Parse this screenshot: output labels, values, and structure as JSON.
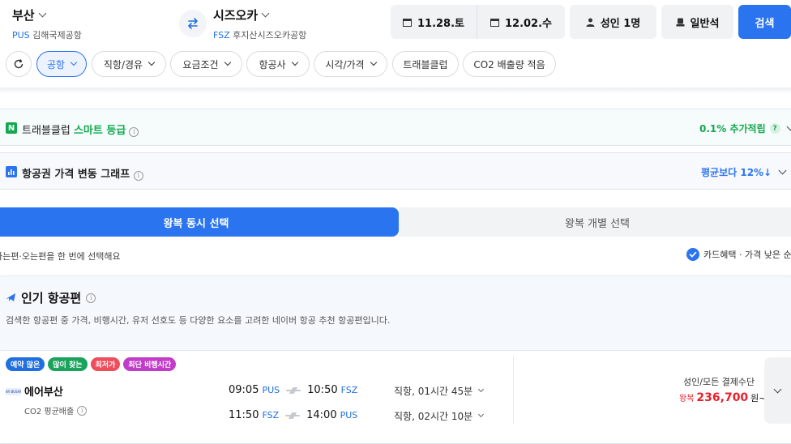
{
  "route": {
    "origin_city": "부산",
    "origin_code": "PUS",
    "origin_airport": "김해국제공항",
    "dest_city": "시즈오카",
    "dest_code": "FSZ",
    "dest_airport": "후지산시즈오카공항"
  },
  "header": {
    "depart_date": "11.28.토",
    "return_date": "12.02.수",
    "passengers": "성인 1명",
    "cabin": "일반석",
    "search_label": "검색"
  },
  "filters": {
    "chips": [
      "공항",
      "직항/경유",
      "요금조건",
      "항공사",
      "시각/가격",
      "트래블클럽",
      "CO2 배출량 적음"
    ]
  },
  "travel_club": {
    "prefix": "트래블클럽",
    "highlight": "스마트 등급",
    "bonus": "0.1% 추가적립",
    "help": "?"
  },
  "price_graph": {
    "label": "항공권 가격 변동 그래프",
    "compare": "평균보다 12%↓"
  },
  "tabs": {
    "roundtrip_together": "왕복 동시 선택",
    "roundtrip_separate": "왕복 개별 선택"
  },
  "subbar": {
    "hint": "가는편·오는편을 한 번에 선택해요",
    "card_benefit": "카드혜택 · 가격 낮은 순"
  },
  "popular": {
    "title": "인기 항공편",
    "description": "검색한 항공편 중 가격, 비행시간, 유저 선호도 등 다양한 요소를 고려한 네이버 항공 추천 항공편입니다."
  },
  "flight": {
    "badges": [
      {
        "label": "예약 많은",
        "color": "#1f6fe0"
      },
      {
        "label": "많이 찾는",
        "color": "#1aa35c"
      },
      {
        "label": "최저가",
        "color": "#ef4d5c"
      },
      {
        "label": "최단 비행시간",
        "color": "#c13cc8"
      }
    ],
    "airline": "에어부산",
    "logo_text": "AIR BUSAN",
    "co2": "CO2 평균배출",
    "outbound": {
      "dep_time": "09:05",
      "dep_code": "PUS",
      "arr_time": "10:50",
      "arr_code": "FSZ",
      "summary": "직항, 01시간 45분"
    },
    "inbound": {
      "dep_time": "11:50",
      "dep_code": "FSZ",
      "arr_time": "14:00",
      "arr_code": "PUS",
      "summary": "직항, 02시간 10분"
    },
    "price_note": "성인/모든 결제수단",
    "price_prefix": "왕복",
    "price": "236,700",
    "price_suffix": "원~"
  },
  "colors": {
    "accent": "#2b74f0",
    "green": "#12a94e",
    "price_red": "#e8202b"
  }
}
